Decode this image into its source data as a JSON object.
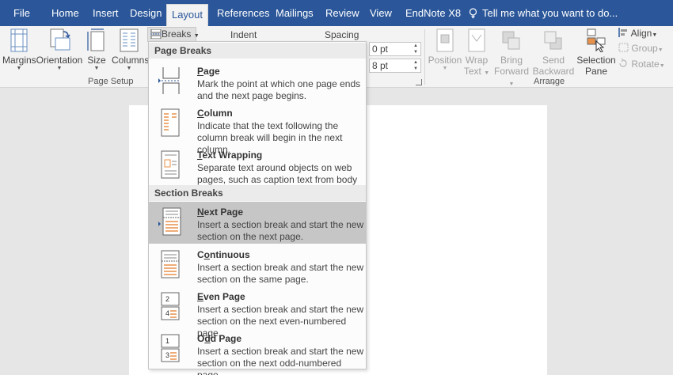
{
  "tabs": [
    {
      "label": "File"
    },
    {
      "label": "Home"
    },
    {
      "label": "Insert"
    },
    {
      "label": "Design"
    },
    {
      "label": "Layout"
    },
    {
      "label": "References"
    },
    {
      "label": "Mailings"
    },
    {
      "label": "Review"
    },
    {
      "label": "View"
    },
    {
      "label": "EndNote X8"
    }
  ],
  "tell_me": "Tell me what you want to do...",
  "ribbon": {
    "page_setup": {
      "margins": "Margins",
      "orientation": "Orientation",
      "size": "Size",
      "columns": "Columns",
      "breaks": "Breaks",
      "group_label": "Page Setup"
    },
    "paragraph": {
      "indent": "Indent",
      "spacing": "Spacing",
      "before_value": "0 pt",
      "after_value": "8 pt"
    },
    "arrange": {
      "position": [
        "Position"
      ],
      "wrap_text": [
        "Wrap",
        "Text"
      ],
      "bring_forward": [
        "Bring",
        "Forward"
      ],
      "send_backward": [
        "Send",
        "Backward"
      ],
      "selection_pane": [
        "Selection",
        "Pane"
      ],
      "align": "Align",
      "group": "Group",
      "rotate": "Rotate",
      "group_label": "Arrange"
    }
  },
  "menu": {
    "page_breaks_header": "Page Breaks",
    "section_breaks_header": "Section Breaks",
    "items": [
      {
        "title_u": "P",
        "title_rest": "age",
        "desc": "Mark the point at which one page ends and the next page begins."
      },
      {
        "title_u": "C",
        "title_rest": "olumn",
        "desc": "Indicate that the text following the column break will begin in the next column."
      },
      {
        "title_u": "T",
        "title_rest": "ext Wrapping",
        "desc": "Separate text around objects on web pages, such as caption text from body text."
      },
      {
        "title_u": "N",
        "title_rest": "ext Page",
        "desc": "Insert a section break and start the new section on the next page."
      },
      {
        "title_pre": "C",
        "title_u": "o",
        "title_rest": "ntinuous",
        "desc": "Insert a section break and start the new section on the same page."
      },
      {
        "title_u": "E",
        "title_rest": "ven Page",
        "desc": "Insert a section break and start the new section on the next even-numbered page."
      },
      {
        "title_pre": "O",
        "title_u": "d",
        "title_rest": "d Page",
        "desc": "Insert a section break and start the new section on the next odd-numbered page."
      }
    ]
  },
  "colors": {
    "tabbar": "#2b579a",
    "accent_orange": "#e8914a",
    "selected_row": "#c6c6c6"
  }
}
